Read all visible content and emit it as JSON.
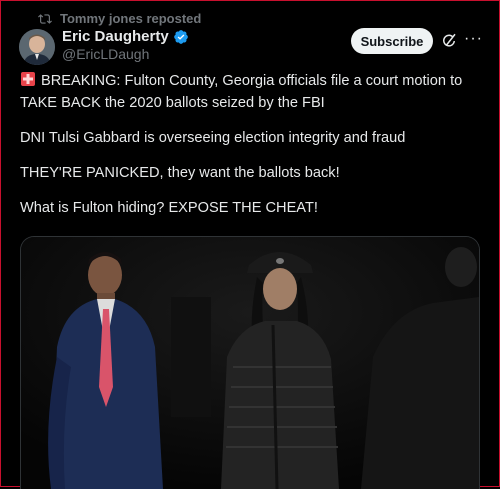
{
  "repost": {
    "icon": "repost-icon",
    "text": "Tommy jones reposted"
  },
  "author": {
    "name": "Eric Daugherty",
    "handle": "@EricLDaugh",
    "verified_color": "#1d9bf0"
  },
  "actions": {
    "subscribe_label": "Subscribe",
    "more_label": "···"
  },
  "tweet": {
    "line1": "BREAKING: Fulton County, Georgia officials file a court motion to TAKE BACK the 2020 ballots seized by the FBI",
    "line2": "DNI Tulsi Gabbard is overseeing election integrity and fraud",
    "line3": "THEY'RE PANICKED, they want the ballots back!",
    "line4": "What is Fulton hiding? EXPOSE THE CHEAT!"
  },
  "colors": {
    "background": "#000000",
    "text": "#e7e9ea",
    "muted": "#71767b",
    "frame": "#c8102e"
  }
}
